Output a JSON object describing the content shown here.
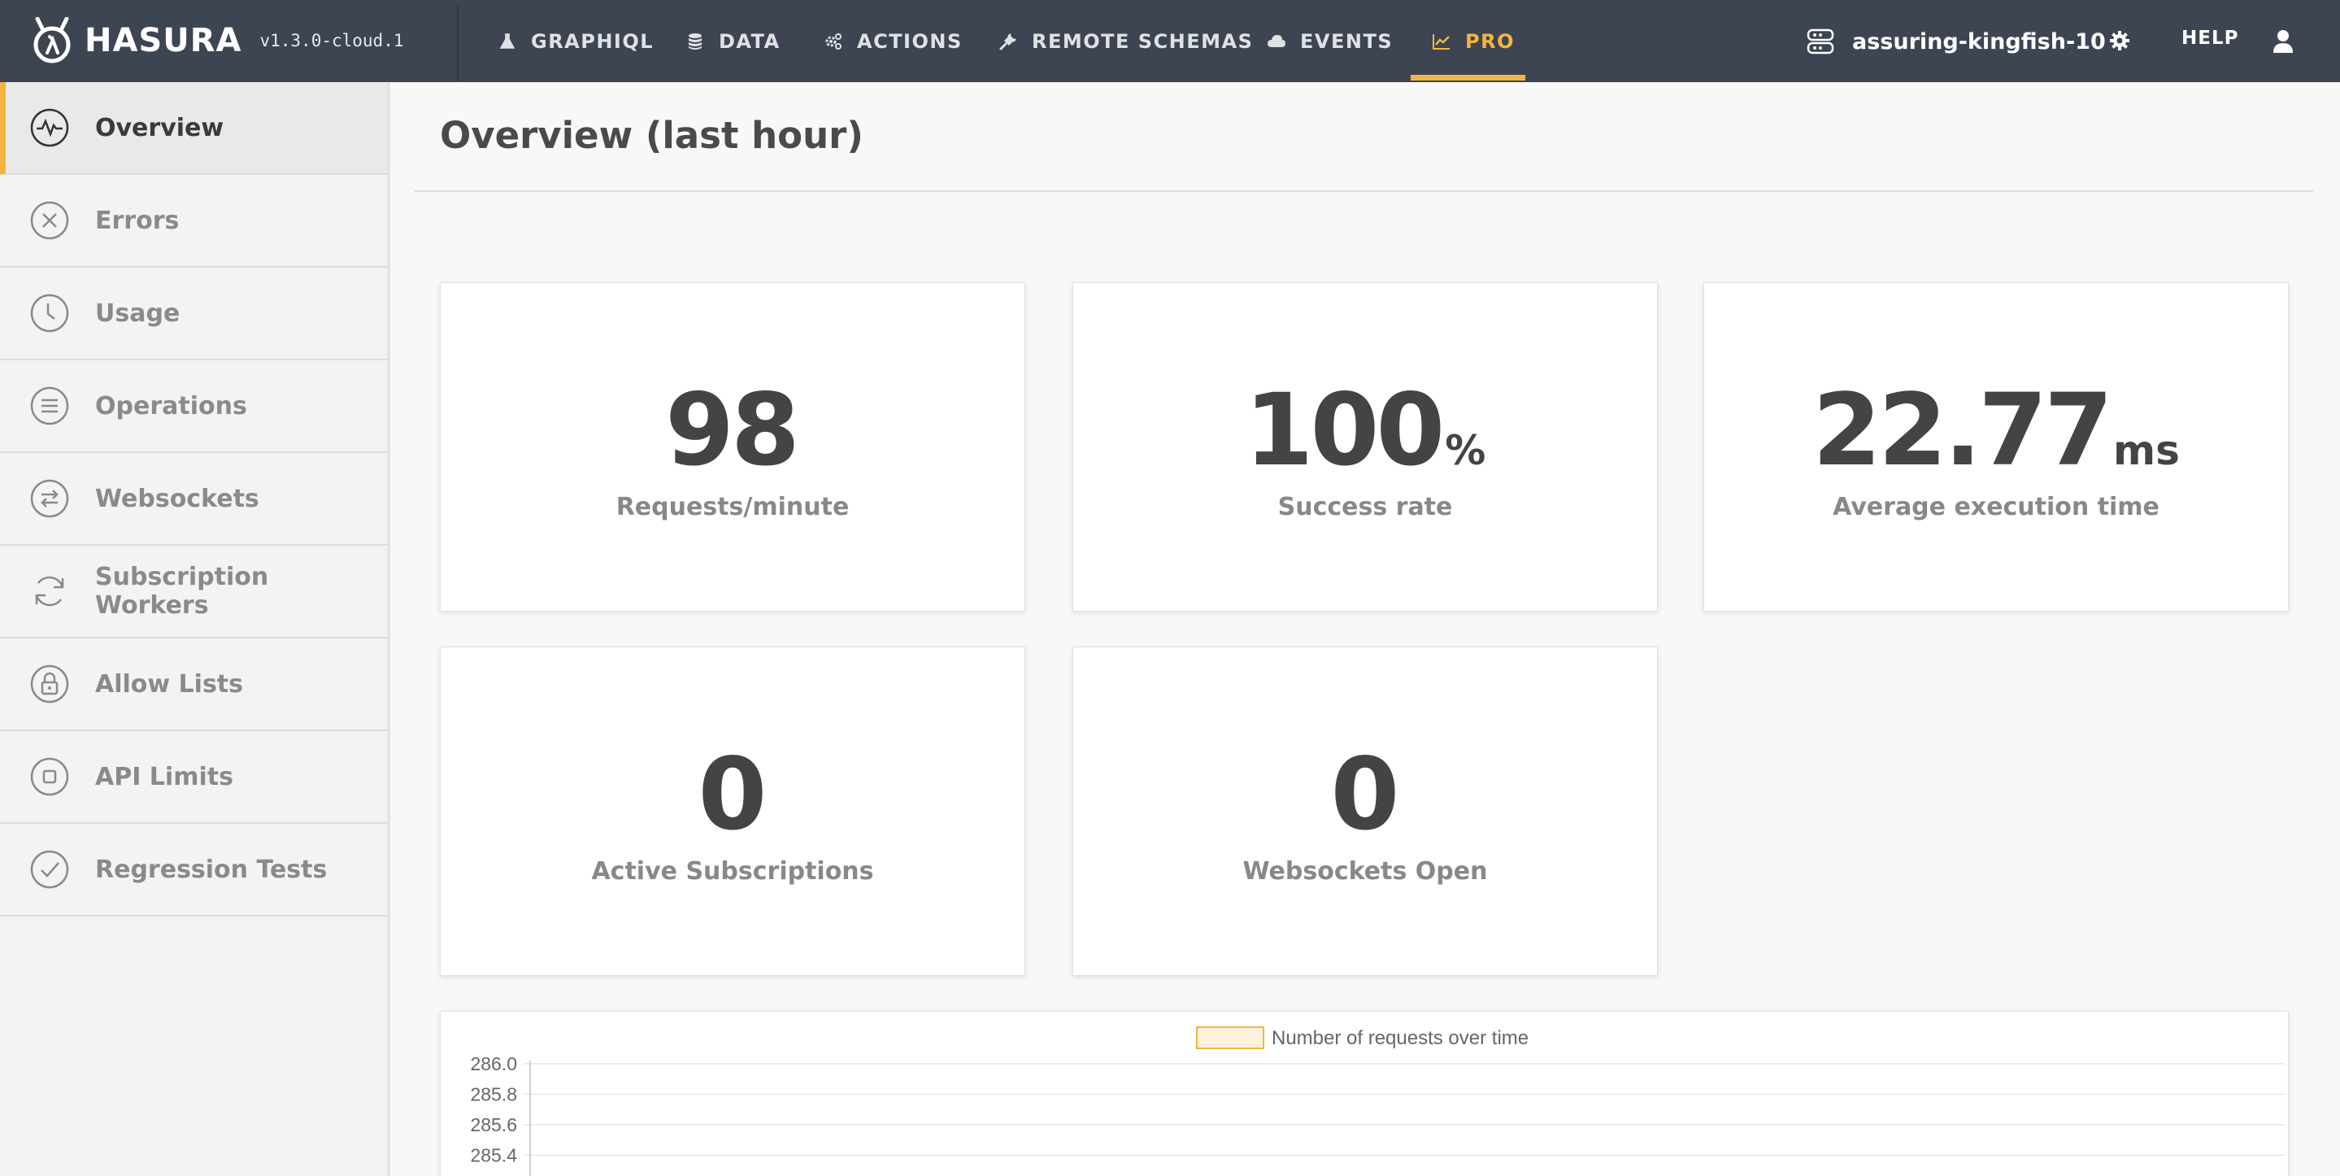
{
  "topnav": {
    "brand": "HASURA",
    "version": "v1.3.0-cloud.1",
    "items": [
      {
        "label": "GRAPHIQL",
        "icon": "flask-icon"
      },
      {
        "label": "DATA",
        "icon": "database-icon"
      },
      {
        "label": "ACTIONS",
        "icon": "cogs-icon"
      },
      {
        "label": "REMOTE SCHEMAS",
        "icon": "plug-icon"
      },
      {
        "label": "EVENTS",
        "icon": "cloud-icon"
      },
      {
        "label": "PRO",
        "icon": "line-chart-icon",
        "active": true
      }
    ],
    "project": "assuring-kingfish-10",
    "help": "HELP"
  },
  "sidebar": {
    "items": [
      {
        "label": "Overview",
        "icon": "pulse-icon",
        "active": true
      },
      {
        "label": "Errors",
        "icon": "x-circle-icon"
      },
      {
        "label": "Usage",
        "icon": "clock-icon"
      },
      {
        "label": "Operations",
        "icon": "list-circle-icon"
      },
      {
        "label": "Websockets",
        "icon": "arrows-exchange-icon"
      },
      {
        "label": "Subscription Workers",
        "icon": "refresh-icon"
      },
      {
        "label": "Allow Lists",
        "icon": "lock-icon"
      },
      {
        "label": "API Limits",
        "icon": "square-circle-icon"
      },
      {
        "label": "Regression Tests",
        "icon": "check-circle-icon"
      }
    ]
  },
  "main": {
    "title": "Overview (last hour)",
    "stats": [
      {
        "value": "98",
        "unit": "",
        "label": "Requests/minute"
      },
      {
        "value": "100",
        "unit": "%",
        "label": "Success rate"
      },
      {
        "value": "22.77",
        "unit": "ms",
        "label": "Average execution time"
      },
      {
        "value": "0",
        "unit": "",
        "label": "Active Subscriptions"
      },
      {
        "value": "0",
        "unit": "",
        "label": "Websockets Open"
      }
    ]
  },
  "colors": {
    "nav_bg": "#3d4452",
    "accent": "#f3b53f",
    "legend_fill": "#fdf3dc"
  },
  "chart_data": {
    "type": "line",
    "legend": [
      "Number of requests over time"
    ],
    "series": [
      {
        "name": "Number of requests over time",
        "values": []
      }
    ],
    "y_ticks": [
      "286.0",
      "285.8",
      "285.6",
      "285.4"
    ],
    "ylim": [
      285.4,
      286.0
    ],
    "grid": true,
    "legend_position": "top-center"
  }
}
